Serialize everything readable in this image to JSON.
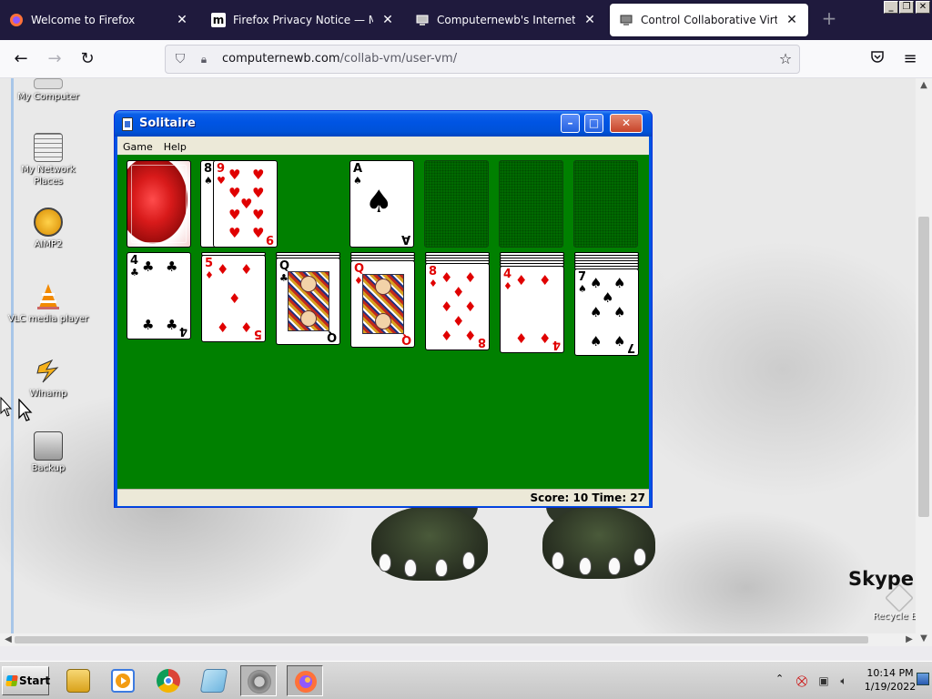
{
  "browser": {
    "tabs": [
      {
        "label": "Welcome to Firefox",
        "favicon": "firefox-icon"
      },
      {
        "label": "Firefox Privacy Notice — Mozilla",
        "favicon": "mozilla-m-icon"
      },
      {
        "label": "Computernewb's Internet Pub Hub",
        "favicon": "computer-icon"
      },
      {
        "label": "Control Collaborative Virtual Machine",
        "favicon": "computer-icon",
        "active": true
      }
    ],
    "new_tab_glyph": "+",
    "url_host": "computernewb.com",
    "url_path": "/collab-vm/user-vm/"
  },
  "window_controls": {
    "minimize": "_",
    "restore": "❐",
    "close": "✕"
  },
  "desktop": {
    "icons": [
      {
        "label": "My Computer"
      },
      {
        "label": "My Network Places"
      },
      {
        "label": "AIMP2"
      },
      {
        "label": "VLC media player"
      },
      {
        "label": "Winamp"
      },
      {
        "label": "Backup"
      }
    ],
    "skype_text": "Skype X",
    "recycle_label": "Recycle Bin"
  },
  "solitaire": {
    "title": "Solitaire",
    "menu": [
      "Game",
      "Help"
    ],
    "status": "Score: 10 Time: 27",
    "waste": [
      {
        "rank": "8",
        "suit": "♠",
        "color": "#000000"
      },
      {
        "rank": "9",
        "suit": "♥",
        "color": "#e00000"
      }
    ],
    "foundation": [
      {
        "rank": "A",
        "suit": "♠",
        "color": "#000000"
      }
    ],
    "tableau": [
      {
        "rank": "4",
        "suit": "♣",
        "color": "#000000",
        "hidden": 0
      },
      {
        "rank": "5",
        "suit": "♦",
        "color": "#e00000",
        "hidden": 1
      },
      {
        "rank": "Q",
        "suit": "♣",
        "color": "#000000",
        "hidden": 2
      },
      {
        "rank": "Q",
        "suit": "♦",
        "color": "#e00000",
        "hidden": 3
      },
      {
        "rank": "8",
        "suit": "♦",
        "color": "#e00000",
        "hidden": 4
      },
      {
        "rank": "4",
        "suit": "♦",
        "color": "#e00000",
        "hidden": 5
      },
      {
        "rank": "7",
        "suit": "♠",
        "color": "#000000",
        "hidden": 6
      }
    ]
  },
  "taskbar": {
    "start_label": "Start",
    "apps": [
      "explorer-icon",
      "media-player-icon",
      "chrome-icon",
      "notepad-icon",
      "settings-gear-icon",
      "firefox-icon"
    ],
    "clock_time": "10:14 PM",
    "clock_date": "1/19/2022"
  }
}
